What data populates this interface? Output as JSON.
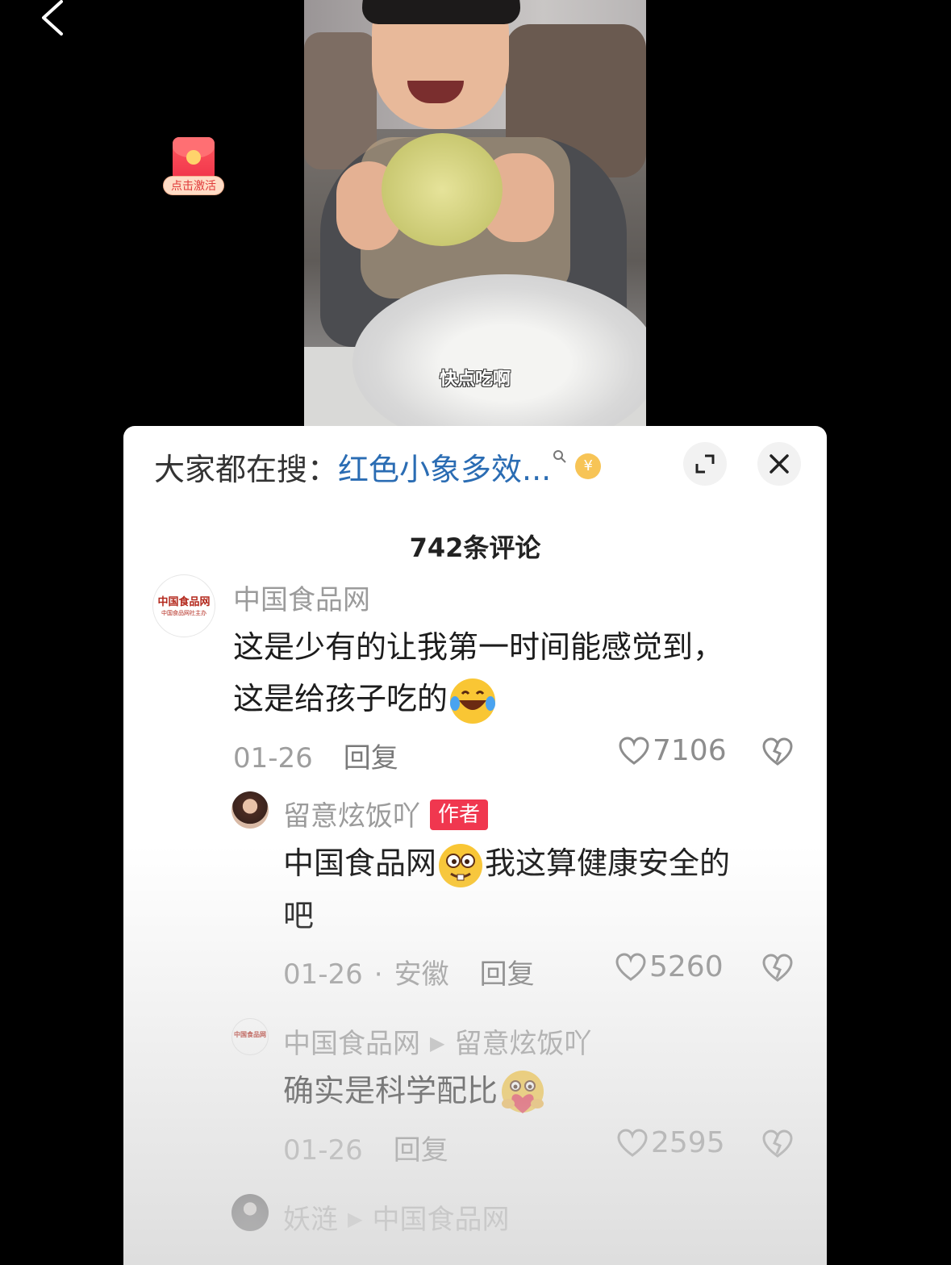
{
  "video": {
    "subtitle": "快点吃啊"
  },
  "red_packet": {
    "label": "点击激活",
    "icon": "red-envelope-icon"
  },
  "search_bar": {
    "prefix": "大家都在搜：",
    "term": "红色小象多效...",
    "search_icon": "search-icon",
    "coin_icon": "coin-icon",
    "coin_symbol": "¥"
  },
  "comments_header": {
    "count": "742条评论"
  },
  "comments": [
    {
      "username": "中国食品网",
      "avatar_text": "中国食品网",
      "avatar_sub": "中国食品网社主办",
      "text_line1": "这是少有的让我第一时间能感觉到，",
      "text_line2": "这是给孩子吃的",
      "emoji": "laugh-cry-emoji",
      "date": "01-26",
      "reply_label": "回复",
      "likes": "7106"
    },
    {
      "username": "留意炫饭吖",
      "author_badge": "作者",
      "mention": "中国食品网",
      "emoji": "silly-face-emoji",
      "text_rest": "我这算健康安全的",
      "text_line2": "吧",
      "date": "01-26",
      "location": "安徽",
      "reply_label": "回复",
      "likes": "5260"
    },
    {
      "username": "中国食品网",
      "reply_to": "留意炫饭吖",
      "avatar_text": "中国食品网",
      "text": "确实是科学配比",
      "emoji": "heart-hug-emoji",
      "date": "01-26",
      "reply_label": "回复",
      "likes": "2595"
    },
    {
      "username": "妖涟",
      "reply_to": "中国食品网"
    }
  ],
  "colors": {
    "link_blue": "#2a6cb3",
    "author_badge_red": "#f0374f",
    "logo_red": "#b3281c"
  }
}
